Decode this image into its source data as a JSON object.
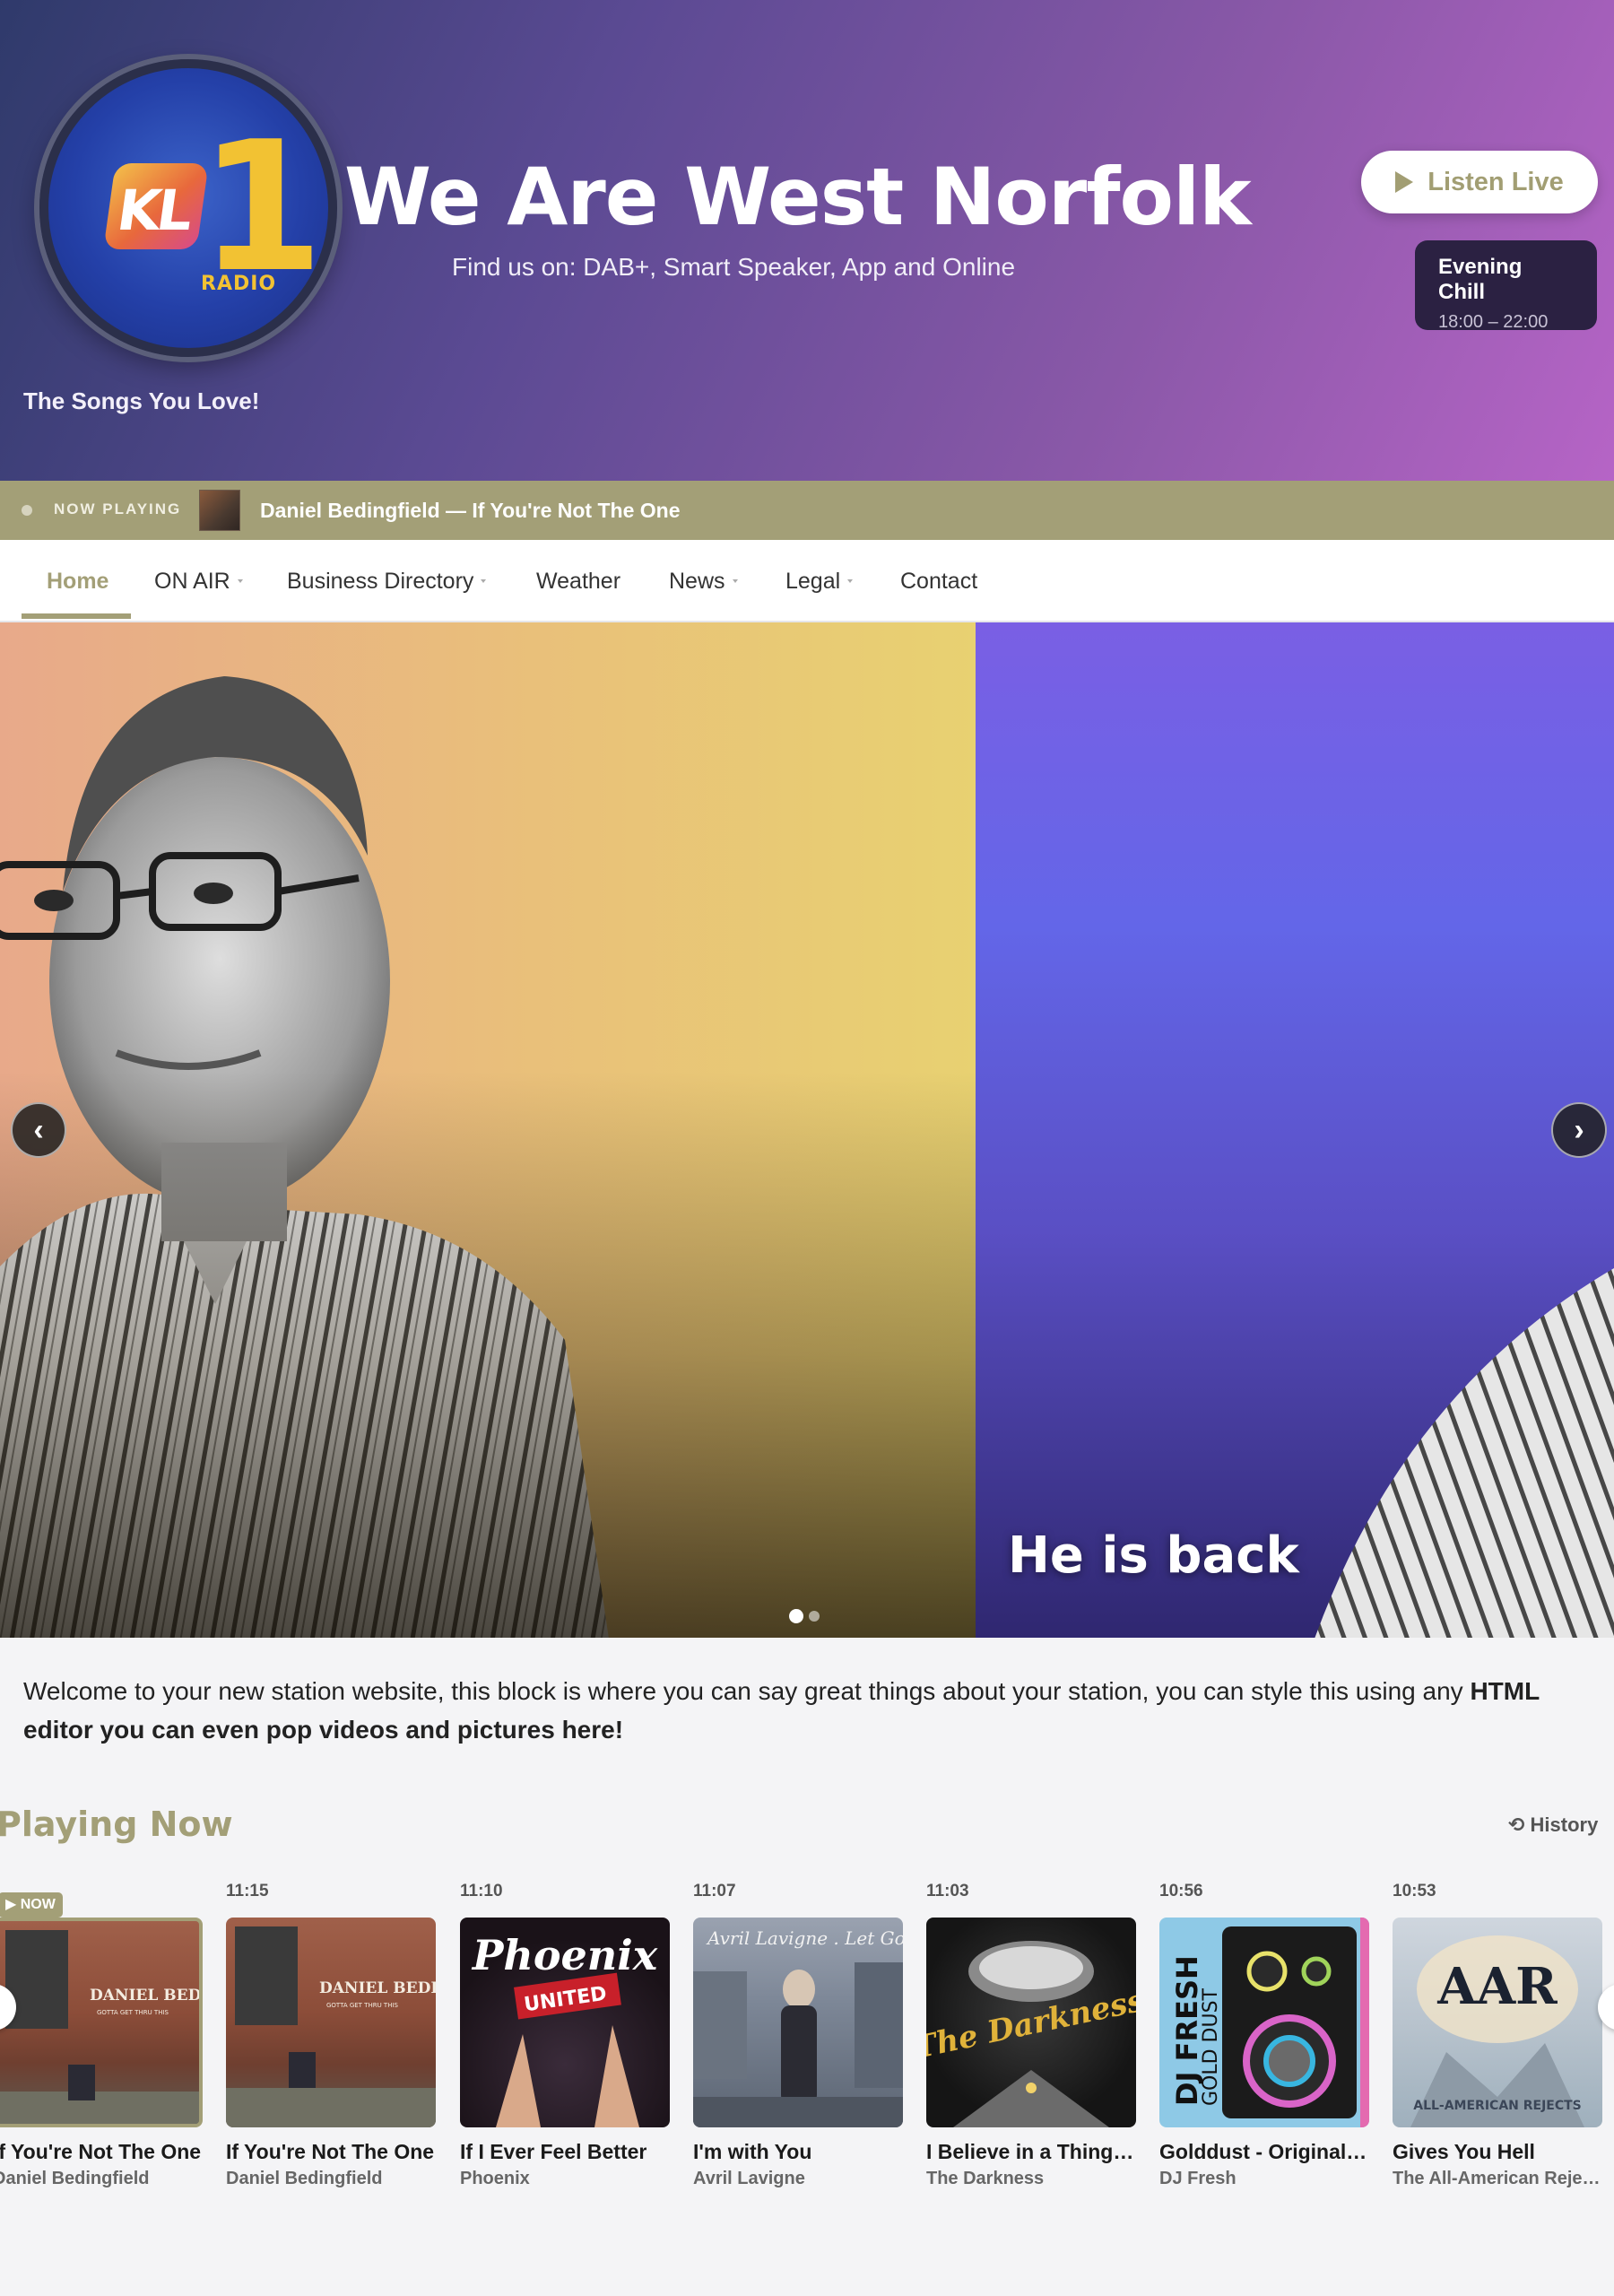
{
  "header": {
    "logo_text": "KL",
    "logo_number": "1",
    "logo_sub": "RADIO",
    "title": "We Are West Norfolk",
    "subtitle": "Find us on: DAB+, Smart Speaker, App and Online",
    "tagline": "The Songs You Love!",
    "listen_label": "Listen Live",
    "show": {
      "name": "Evening Chill",
      "hours": "18:00 – 22:00"
    }
  },
  "now_playing_bar": {
    "label": "NOW PLAYING",
    "track": "Daniel Bedingfield — If You're Not The One"
  },
  "nav": {
    "items": [
      {
        "label": "Home",
        "active": true
      },
      {
        "label": "ON AIR",
        "dropdown": true
      },
      {
        "label": "Business Directory",
        "dropdown": true
      },
      {
        "label": "Weather"
      },
      {
        "label": "News",
        "dropdown": true
      },
      {
        "label": "Legal",
        "dropdown": true
      },
      {
        "label": "Contact"
      }
    ]
  },
  "hero": {
    "caption": "He is back",
    "prev_icon": "chevron-left-icon",
    "next_icon": "chevron-right-icon",
    "prev_glyph": "‹",
    "next_glyph": "›",
    "slides_total": 2,
    "slide_active": 1
  },
  "welcome": {
    "text": "Welcome to your new station website, this block is where you can say great things about your station, you can style this using any ",
    "bold": "HTML editor you can even pop videos and pictures here!"
  },
  "playing_now": {
    "title": "Playing Now",
    "history_label": "History",
    "now_badge": "▶ NOW",
    "tracks": [
      {
        "time": "",
        "title": "If You're Not The One",
        "artist": "Daniel Bedingfield"
      },
      {
        "time": "11:15",
        "title": "If You're Not The One",
        "artist": "Daniel Bedingfield"
      },
      {
        "time": "11:10",
        "title": "If I Ever Feel Better",
        "artist": "Phoenix"
      },
      {
        "time": "11:07",
        "title": "I'm with You",
        "artist": "Avril Lavigne"
      },
      {
        "time": "11:03",
        "title": "I Believe in a Thing Called Love",
        "artist": "The Darkness"
      },
      {
        "time": "10:56",
        "title": "Golddust - Original Mix",
        "artist": "DJ Fresh"
      },
      {
        "time": "10:53",
        "title": "Gives You Hell",
        "artist": "The All-American Rejects"
      }
    ],
    "art_text": {
      "bedingfield_1": "DANIEL BEDINGFIELD",
      "bedingfield_2": "GOTTA GET THRU THIS",
      "phoenix_1": "Phoenix",
      "phoenix_2": "UNITED",
      "avril": "Avril Lavigne . Let Go",
      "darkness": "The Darkness",
      "djfresh_1": "DJ FRESH",
      "djfresh_2": "GOLD DUST",
      "aar_1": "AAR",
      "aar_2": "ALL-AMERICAN REJECTS"
    }
  },
  "colors": {
    "accent": "#a39f77",
    "header_start": "#2f3a6b",
    "header_end": "#b664c6",
    "show_card": "#2b2142"
  }
}
